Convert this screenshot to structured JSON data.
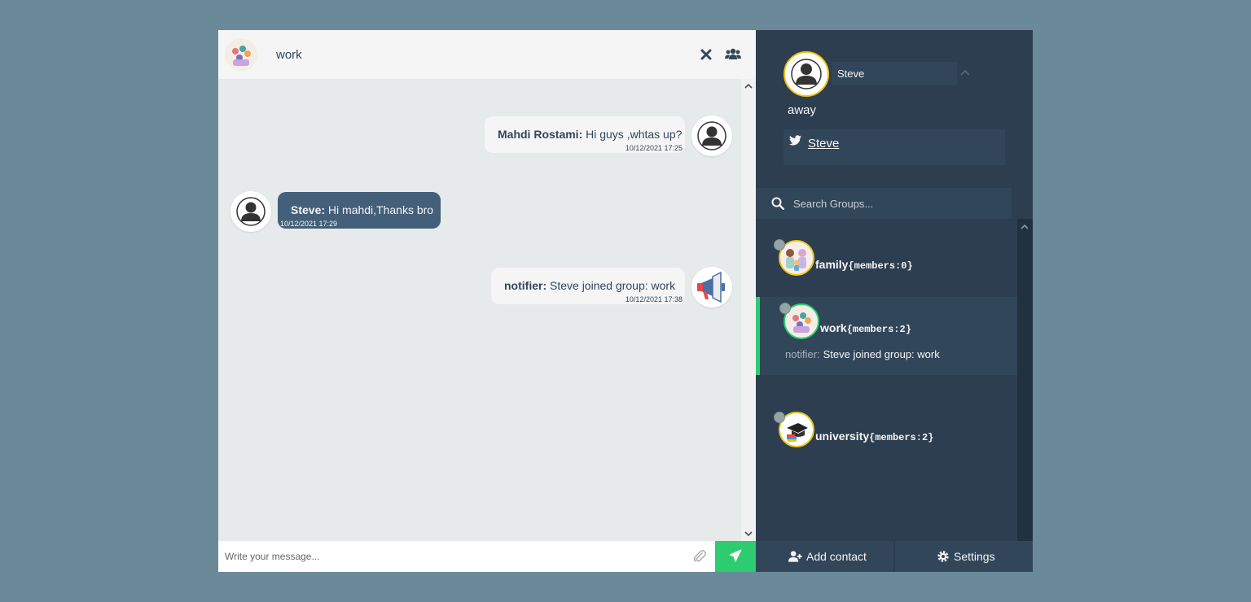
{
  "chat": {
    "title": "work",
    "close_icon": "close-icon",
    "group_icon": "users-icon",
    "messages": [
      {
        "direction": "replies",
        "sender": "Mahdi Rostami:",
        "text": "Hi guys ,whtas up?",
        "time": "10/12/2021 17:25",
        "avatar": "user-silhouette"
      },
      {
        "direction": "sent",
        "sender": "Steve:",
        "text": "Hi mahdi,Thanks bro",
        "time": "10/12/2021 17:29",
        "avatar": "user-silhouette"
      },
      {
        "direction": "replies",
        "sender": "notifier:",
        "text": "Steve joined group: work",
        "time": "10/12/2021 17:38",
        "avatar": "megaphone"
      }
    ],
    "composer": {
      "placeholder": "Write your message...",
      "attach_icon": "paperclip-icon",
      "send_icon": "paper-plane-icon"
    }
  },
  "profile": {
    "name": "Steve",
    "status": "away",
    "twitter": "Steve"
  },
  "search": {
    "placeholder": "Search Groups..."
  },
  "groups": [
    {
      "name": "family",
      "members": "{members:0}",
      "active": false,
      "preview_sender": "",
      "preview_text": ""
    },
    {
      "name": "work",
      "members": "{members:2}",
      "active": true,
      "preview_sender": "notifier:",
      "preview_text": "Steve joined group: work"
    },
    {
      "name": "university",
      "members": "{members:2}",
      "active": false,
      "preview_sender": "",
      "preview_text": ""
    }
  ],
  "bottom": {
    "add_contact": "Add contact",
    "settings": "Settings"
  },
  "colors": {
    "accent_green": "#2ecc71",
    "sidebar": "#2c3e50",
    "panel": "#32465a",
    "away_ring": "#f1c40f"
  }
}
